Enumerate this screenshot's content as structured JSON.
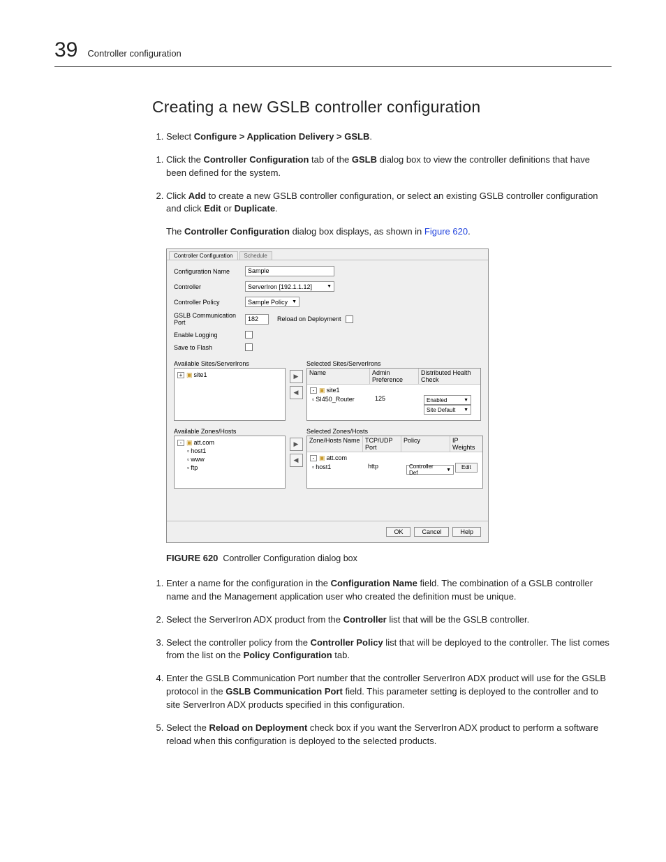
{
  "header": {
    "chapter_number": "39",
    "chapter_title": "Controller configuration"
  },
  "section": {
    "title": "Creating a new GSLB controller configuration"
  },
  "steps_top": [
    {
      "n": "1",
      "pre": "Select ",
      "bold": "Configure > Application Delivery > GSLB",
      "post": "."
    },
    {
      "n": "1",
      "pre": "Click the ",
      "bold": "Controller Configuration",
      "mid": " tab of the ",
      "bold2": "GSLB",
      "post": " dialog box to view the controller definitions that have been defined for the system."
    },
    {
      "n": "2",
      "pre": "Click ",
      "bold": "Add",
      "mid": " to create a new GSLB controller configuration, or select an existing GSLB controller configuration and click ",
      "bold2": "Edit",
      "mid2": " or ",
      "bold3": "Duplicate",
      "post": "."
    }
  ],
  "para_between": {
    "pre": "The ",
    "bold": "Controller Configuration",
    "mid": " dialog box displays, as shown in ",
    "ref": "Figure 620",
    "post": "."
  },
  "dialog": {
    "tabs": [
      "Controller Configuration",
      "Schedule"
    ],
    "fields": {
      "config_name_lbl": "Configuration Name",
      "config_name_val": "Sample",
      "controller_lbl": "Controller",
      "controller_val": "ServerIron [192.1.1.12]",
      "policy_lbl": "Controller Policy",
      "policy_val": "Sample Policy",
      "port_lbl": "GSLB Communication Port",
      "port_val": "182",
      "reload_lbl": "Reload on Deployment",
      "logging_lbl": "Enable Logging",
      "flash_lbl": "Save to Flash"
    },
    "sites": {
      "avail_title": "Available Sites/ServerIrons",
      "sel_title": "Selected Sites/ServerIrons",
      "avail_tree": [
        {
          "type": "folder",
          "expand": "+",
          "label": "site1"
        }
      ],
      "sel_headers": [
        "Name",
        "Admin Preference",
        "Distributed Health Check"
      ],
      "sel_tree": [
        {
          "type": "folder",
          "expand": "-",
          "label": "site1"
        },
        {
          "type": "file",
          "indent": 1,
          "label": "SI450_Router",
          "col2": "125",
          "col3a": "Enabled",
          "col3b": "Site Default"
        }
      ]
    },
    "zones": {
      "avail_title": "Available Zones/Hosts",
      "sel_title": "Selected Zones/Hosts",
      "avail_tree": [
        {
          "type": "folder",
          "expand": "-",
          "label": "att.com"
        },
        {
          "type": "file",
          "indent": 1,
          "label": "host1"
        },
        {
          "type": "file",
          "indent": 1,
          "label": "www"
        },
        {
          "type": "file",
          "indent": 1,
          "label": "ftp"
        }
      ],
      "sel_headers": [
        "Zone/Hosts Name",
        "TCP/UDP Port",
        "Policy",
        "IP Weights"
      ],
      "sel_tree": [
        {
          "type": "folder",
          "expand": "-",
          "label": "att.com"
        },
        {
          "type": "file",
          "indent": 1,
          "label": "host1",
          "col2": "http",
          "col3": "Controller Def",
          "col4": "Edit"
        }
      ]
    },
    "buttons": {
      "ok": "OK",
      "cancel": "Cancel",
      "help": "Help"
    }
  },
  "figure": {
    "num": "FIGURE 620",
    "caption": "Controller Configuration dialog box"
  },
  "steps_bottom": [
    {
      "n": "1",
      "pre": "Enter a name for the configuration in the ",
      "bold": "Configuration Name",
      "post": " field. The combination of a GSLB controller name and the Management application user who created the definition must be unique."
    },
    {
      "n": "2",
      "pre": "Select the ServerIron ADX product from the ",
      "bold": "Controller",
      "post": " list that will be the GSLB controller."
    },
    {
      "n": "3",
      "pre": "Select the controller policy from the ",
      "bold": "Controller Policy",
      "mid": " list that will be deployed to the controller. The list comes from the list on the ",
      "bold2": "Policy Configuration",
      "post": " tab."
    },
    {
      "n": "4",
      "pre": "Enter the GSLB Communication Port number that the controller ServerIron ADX product will use for the GSLB protocol in the ",
      "bold": "GSLB Communication Port",
      "post": " field. This parameter setting is deployed to the controller and to site ServerIron ADX products specified in this configuration."
    },
    {
      "n": "5",
      "pre": "Select the ",
      "bold": "Reload on Deployment",
      "post": " check box if you want the ServerIron ADX product to perform a software reload when this configuration is deployed to the selected products."
    }
  ]
}
